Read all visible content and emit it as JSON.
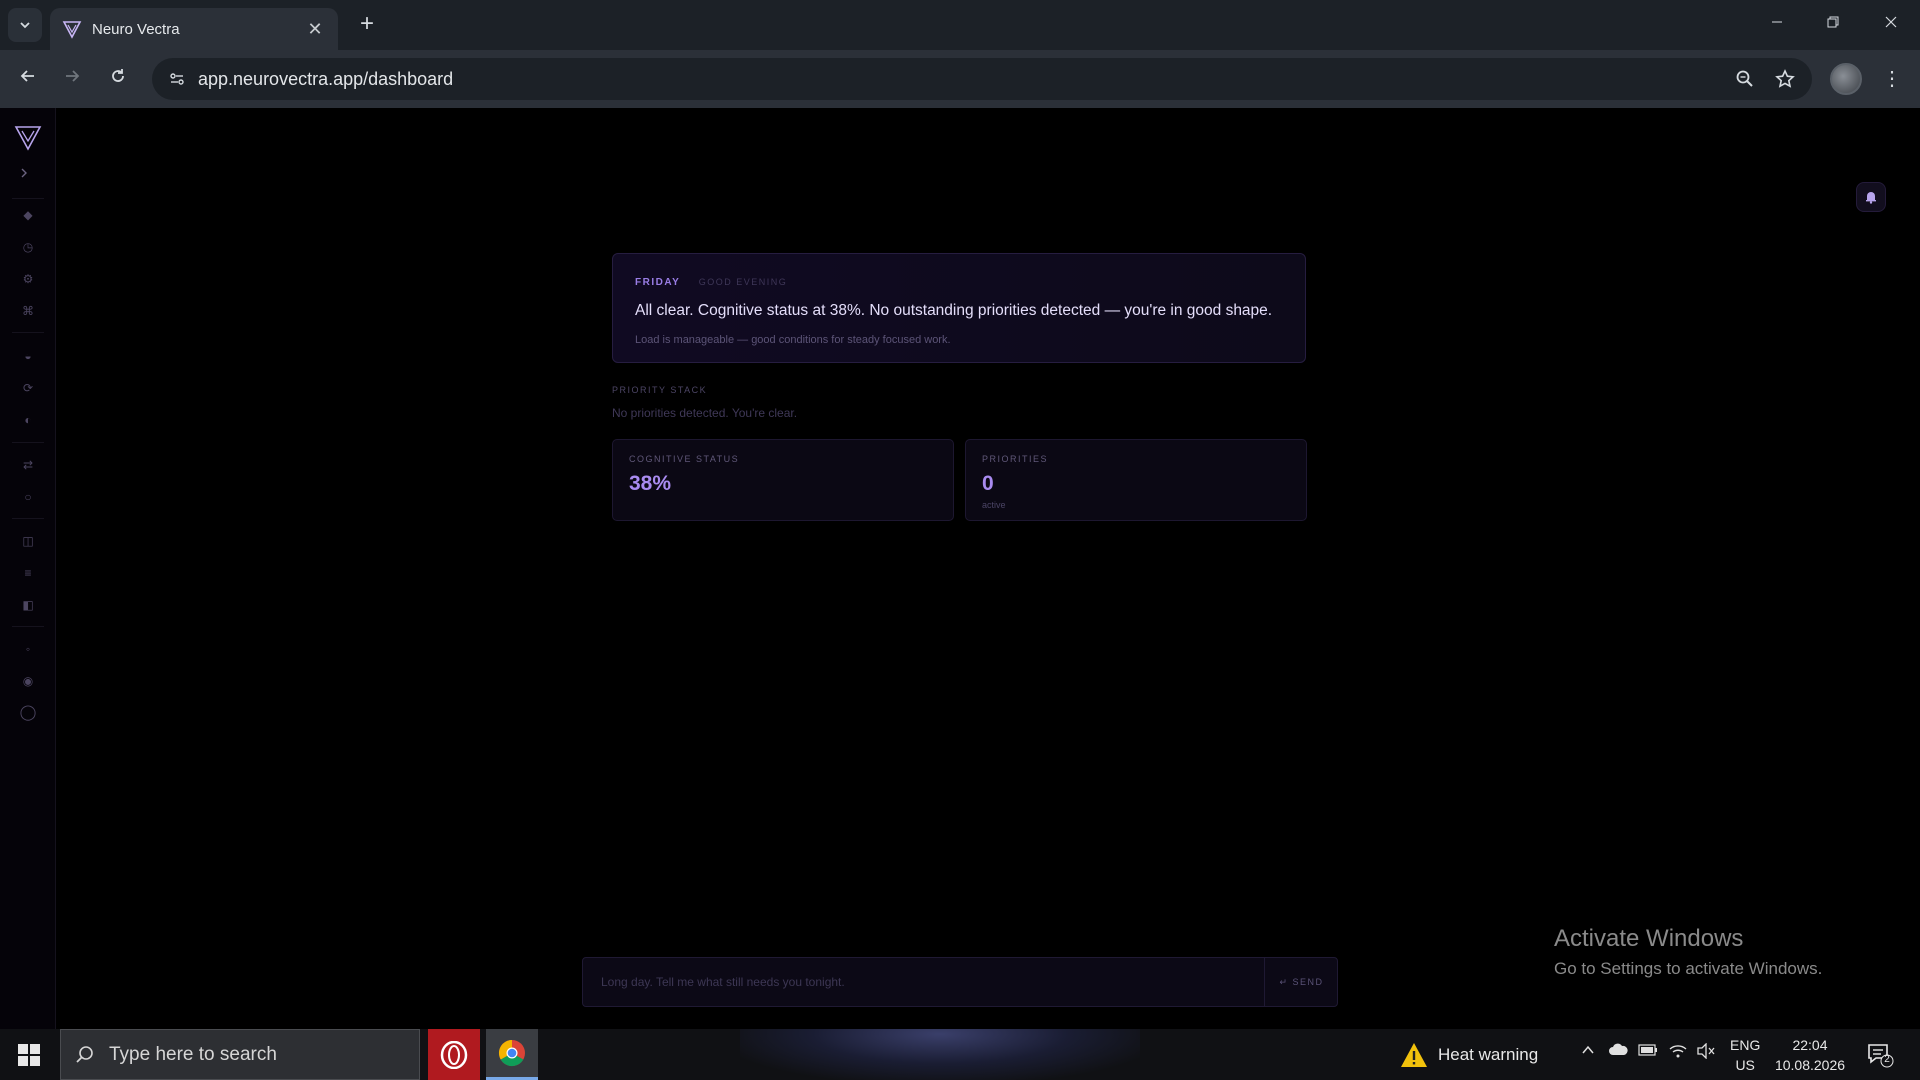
{
  "browser": {
    "tab_title": "Neuro Vectra",
    "tab_close": "✕",
    "new_tab": "+",
    "url": "app.neurovectra.app/dashboard",
    "icons": [
      "tab-search-icon",
      "back-icon",
      "forward-icon",
      "reload-icon",
      "site-info-icon",
      "zoom-icon",
      "bookmark-star-icon",
      "profile-avatar",
      "menu-icon"
    ]
  },
  "sidebar": {
    "icons": [
      "logo-icon",
      "expand-icon",
      "nav-icon-1",
      "nav-icon-2",
      "nav-icon-3",
      "nav-icon-4",
      "nav-icon-5",
      "nav-icon-6",
      "nav-icon-7",
      "nav-icon-8",
      "nav-icon-9",
      "nav-icon-10",
      "nav-icon-11",
      "nav-icon-12",
      "nav-icon-13",
      "nav-icon-14",
      "nav-icon-15"
    ]
  },
  "briefing": {
    "day": "FRIDAY",
    "greeting": "GOOD EVENING",
    "message": "All clear. Cognitive status at 38%. No outstanding priorities detected — you're in good shape.",
    "subtext": "Load is manageable — good conditions for steady focused work."
  },
  "priority_stack": {
    "label": "PRIORITY STACK",
    "empty_text": "No priorities detected. You're clear."
  },
  "cards": {
    "cognitive": {
      "label": "COGNITIVE STATUS",
      "value": "38%"
    },
    "priorities": {
      "label": "PRIORITIES",
      "value": "0",
      "sub": "active"
    }
  },
  "chat": {
    "placeholder": "Long day. Tell me what still needs you tonight.",
    "send_label": "↵ SEND"
  },
  "watermark": {
    "title": "Activate Windows",
    "subtitle": "Go to Settings to activate Windows."
  },
  "taskbar": {
    "search_placeholder": "Type here to search",
    "weather": "Heat warning",
    "lang_top": "ENG",
    "lang_bottom": "US",
    "time": "22:04",
    "date": "10.08.2026",
    "notification_count": "2"
  },
  "colors": {
    "accent": "#a98bf0",
    "day_label": "#9a7ee6",
    "background": "#000000"
  }
}
